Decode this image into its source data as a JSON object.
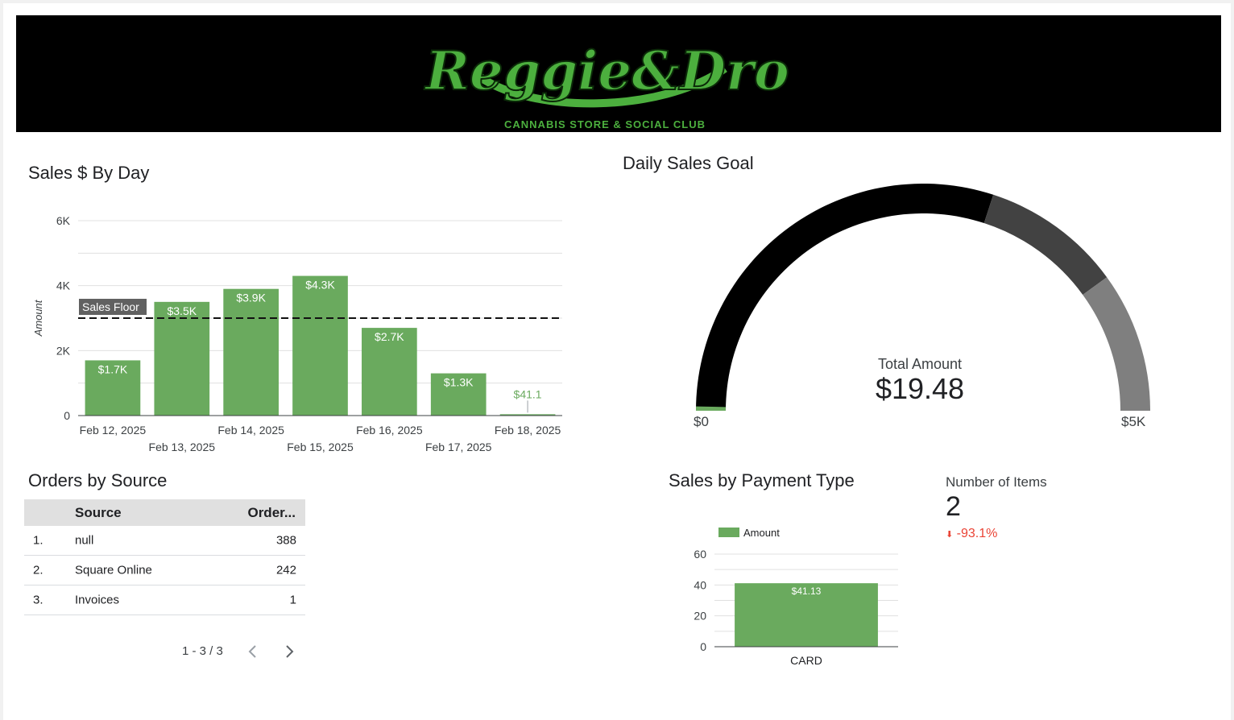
{
  "banner": {
    "logo_text": "Reggie&Dro",
    "tagline": "CANNABIS STORE & SOCIAL CLUB",
    "colors": {
      "background": "#000000",
      "logo": "#4caf3e"
    }
  },
  "sales_by_day": {
    "title": "Sales $ By Day",
    "reference_line_label": "Sales Floor"
  },
  "daily_sales_goal": {
    "title": "Daily Sales Goal",
    "metric_label": "Total Amount",
    "metric_value": "$19.48",
    "min_label": "$0",
    "max_label": "$5K",
    "value": 19.48,
    "max": 5000,
    "band_colors": [
      "#000000",
      "#424242",
      "#7f7f7f"
    ],
    "value_color": "#6aaa5e"
  },
  "orders_by_source": {
    "title": "Orders by Source",
    "columns": [
      "",
      "Source",
      "Order..."
    ],
    "rows": [
      {
        "index": "1.",
        "source": "null",
        "orders": "388"
      },
      {
        "index": "2.",
        "source": "Square Online",
        "orders": "242"
      },
      {
        "index": "3.",
        "source": "Invoices",
        "orders": "1"
      }
    ],
    "pagination": "1 - 3 / 3",
    "prev_icon": "chevron-left-icon",
    "next_icon": "chevron-right-icon"
  },
  "sales_by_payment_type": {
    "title": "Sales by Payment Type"
  },
  "number_of_items": {
    "label": "Number of Items",
    "value": "2",
    "delta": "-93.1%",
    "delta_icon": "arrow-down-icon",
    "delta_color": "#ea4335"
  },
  "chart_data": [
    {
      "type": "bar",
      "title": "Sales $ By Day",
      "xlabel": "",
      "ylabel": "Amount",
      "categories": [
        "Feb 12, 2025",
        "Feb 13, 2025",
        "Feb 14, 2025",
        "Feb 15, 2025",
        "Feb 16, 2025",
        "Feb 17, 2025",
        "Feb 18, 2025"
      ],
      "values": [
        1700,
        3500,
        3900,
        4300,
        2700,
        1300,
        41.1
      ],
      "data_labels": [
        "$1.7K",
        "$3.5K",
        "$3.9K",
        "$4.3K",
        "$2.7K",
        "$1.3K",
        "$41.1"
      ],
      "ylim": [
        0,
        6000
      ],
      "yticks": [
        0,
        2000,
        4000,
        6000
      ],
      "ytick_labels": [
        "0",
        "2K",
        "4K",
        "6K"
      ],
      "reference_line": {
        "label": "Sales Floor",
        "value": 3000,
        "style": "dashed"
      },
      "grid": true,
      "bar_color": "#6aaa5e"
    },
    {
      "type": "bar",
      "title": "Sales by Payment Type",
      "categories": [
        "CARD"
      ],
      "series": [
        {
          "name": "Amount",
          "values": [
            41.13
          ]
        }
      ],
      "data_labels": [
        "$41.13"
      ],
      "ylim": [
        0,
        60
      ],
      "yticks": [
        0,
        20,
        40,
        60
      ],
      "ytick_labels": [
        "0",
        "20",
        "40",
        "60"
      ],
      "legend": "top-left",
      "grid": true,
      "bar_color": "#6aaa5e"
    }
  ]
}
